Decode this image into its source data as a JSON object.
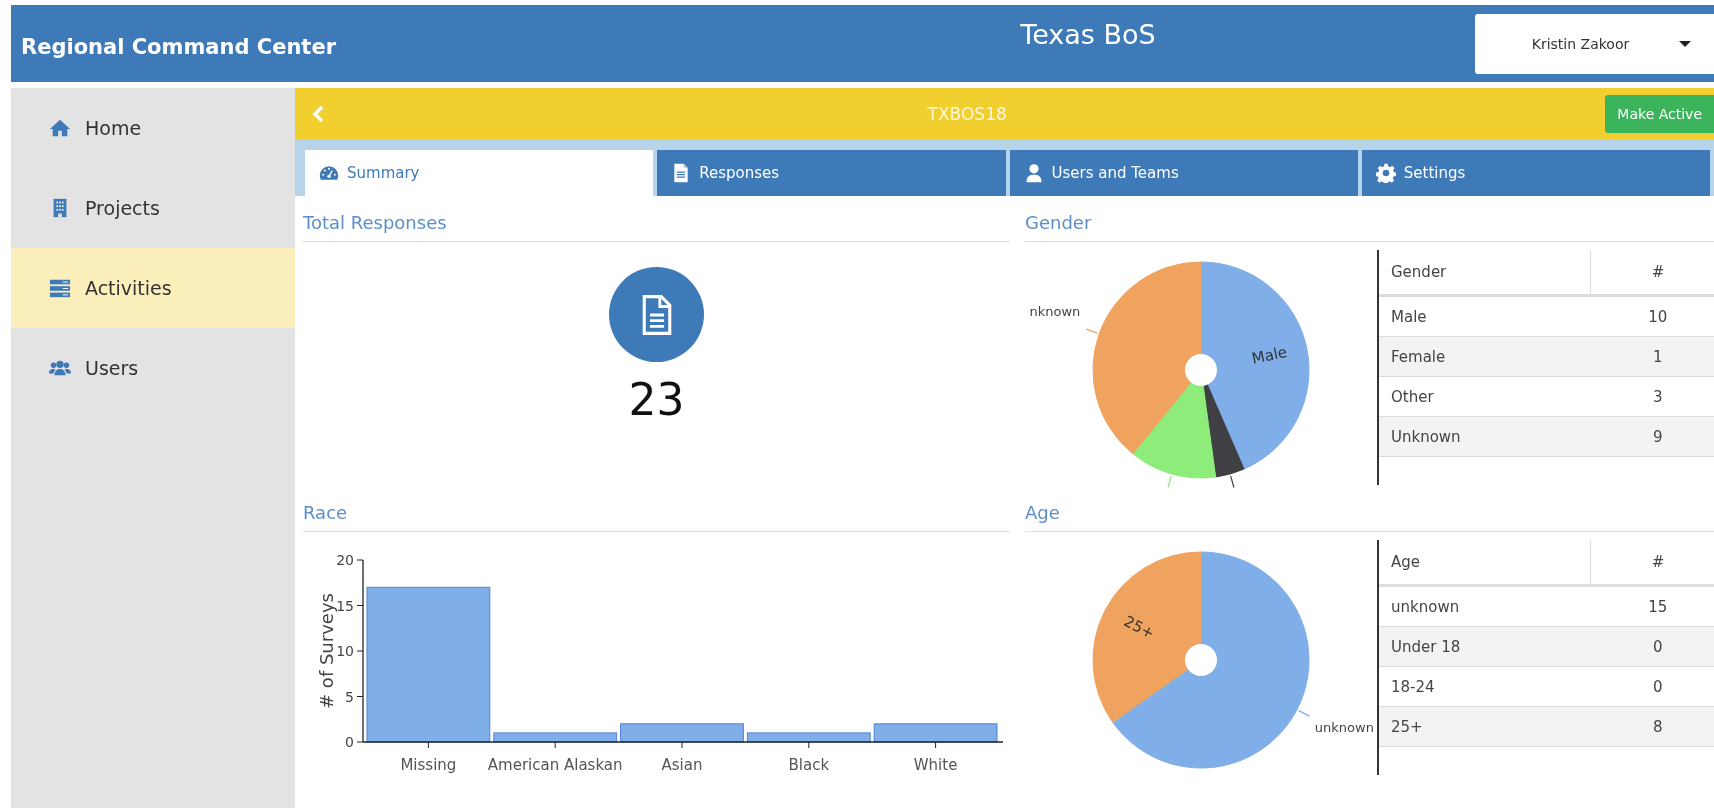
{
  "header": {
    "app_title": "Regional Command Center",
    "page_title": "Texas BoS",
    "user": "Kristin Zakoor"
  },
  "sidebar": {
    "items": [
      {
        "label": "Home",
        "selected": false
      },
      {
        "label": "Projects",
        "selected": false
      },
      {
        "label": "Activities",
        "selected": true
      },
      {
        "label": "Users",
        "selected": false
      }
    ]
  },
  "project_bar": {
    "code": "TXBOS18",
    "action": "Make Active"
  },
  "tabs": [
    {
      "label": "Summary",
      "selected": true
    },
    {
      "label": "Responses",
      "selected": false
    },
    {
      "label": "Users and Teams",
      "selected": false
    },
    {
      "label": "Settings",
      "selected": false
    }
  ],
  "total_responses": {
    "title": "Total Responses",
    "count": "23"
  },
  "gender": {
    "title": "Gender",
    "chart_data": {
      "type": "pie",
      "categories": [
        "Male",
        null,
        null,
        "nknown"
      ],
      "values": [
        43.48,
        4.35,
        13.04,
        39.13
      ],
      "colors": [
        "#80aee8",
        "#3f3f44",
        "#8eec7b",
        "#f0a35e"
      ]
    },
    "table": {
      "columns": [
        "Gender",
        "#"
      ],
      "rows": [
        [
          "Male",
          "10"
        ],
        [
          "Female",
          "1"
        ],
        [
          "Other",
          "3"
        ],
        [
          "Unknown",
          "9"
        ]
      ]
    }
  },
  "race": {
    "title": "Race",
    "chart_data": {
      "type": "bar",
      "ylabel": "# of Surveys",
      "categories": [
        "Missing",
        "American Alaskan",
        "Asian",
        "Black",
        "White"
      ],
      "values": [
        17,
        1,
        2,
        1,
        2
      ],
      "ylim": [
        0,
        20
      ],
      "yticks": [
        0,
        5,
        10,
        15,
        20
      ]
    }
  },
  "age": {
    "title": "Age",
    "chart_data": {
      "type": "pie",
      "categories": [
        "unknown",
        null,
        null,
        "25+"
      ],
      "values": [
        65.22,
        0,
        0,
        34.78
      ],
      "colors": [
        "#80aee8",
        null,
        null,
        "#f0a35e"
      ]
    },
    "table": {
      "columns": [
        "Age",
        "#"
      ],
      "rows": [
        [
          "unknown",
          "15"
        ],
        [
          "Under 18",
          "0"
        ],
        [
          "18-24",
          "0"
        ],
        [
          "25+",
          "8"
        ]
      ]
    }
  }
}
